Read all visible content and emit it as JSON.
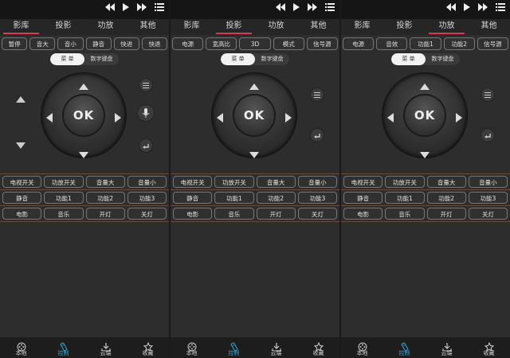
{
  "panels": [
    {
      "tabs": [
        "影库",
        "投影",
        "功放",
        "其他"
      ],
      "active_tab": 0,
      "top_buttons": [
        "暂停",
        "音大",
        "音小",
        "静音",
        "快进",
        "快退"
      ],
      "toggle": {
        "left": "菜 单",
        "right": "数字键盘"
      },
      "ok_label": "OK",
      "grid": [
        [
          "电视开关",
          "功放开关",
          "音量大",
          "音量小"
        ],
        [
          "静音",
          "功能1",
          "功能2",
          "功能3"
        ],
        [
          "电影",
          "音乐",
          "开灯",
          "关灯"
        ]
      ],
      "nav": [
        "本地",
        "控制",
        "云端",
        "收藏"
      ]
    },
    {
      "tabs": [
        "影库",
        "投影",
        "功放",
        "其他"
      ],
      "active_tab": 1,
      "top_buttons": [
        "电源",
        "宽高比",
        "3D",
        "模式",
        "信号源"
      ],
      "toggle": {
        "left": "菜 单",
        "right": "数字键盘"
      },
      "ok_label": "OK",
      "grid": [
        [
          "电视开关",
          "功放开关",
          "音量大",
          "音量小"
        ],
        [
          "静音",
          "功能1",
          "功能2",
          "功能3"
        ],
        [
          "电影",
          "音乐",
          "开灯",
          "关灯"
        ]
      ],
      "nav": [
        "本地",
        "控制",
        "云端",
        "收藏"
      ]
    },
    {
      "tabs": [
        "影库",
        "投影",
        "功放",
        "其他"
      ],
      "active_tab": 2,
      "top_buttons": [
        "电源",
        "音效",
        "功能1",
        "功能2",
        "信号源"
      ],
      "toggle": {
        "left": "菜 单",
        "right": "数字键盘"
      },
      "ok_label": "OK",
      "grid": [
        [
          "电视开关",
          "功放开关",
          "音量大",
          "音量小"
        ],
        [
          "静音",
          "功能1",
          "功能2",
          "功能3"
        ],
        [
          "电影",
          "音乐",
          "开灯",
          "关灯"
        ]
      ],
      "nav": [
        "本地",
        "控制",
        "云端",
        "收藏"
      ]
    }
  ],
  "colors": {
    "accent": "#d83a5a",
    "nav_active": "#39a8d8",
    "background": "#2d2d2d"
  },
  "icons": {
    "prev": "rewind-icon",
    "play": "play-icon",
    "next": "fast-forward-icon",
    "playlist": "playlist-icon",
    "menu": "menu-icon",
    "mic": "microphone-icon",
    "back": "back-icon",
    "nav": [
      "film-reel-icon",
      "remote-icon",
      "cloud-download-icon",
      "star-icon"
    ]
  }
}
